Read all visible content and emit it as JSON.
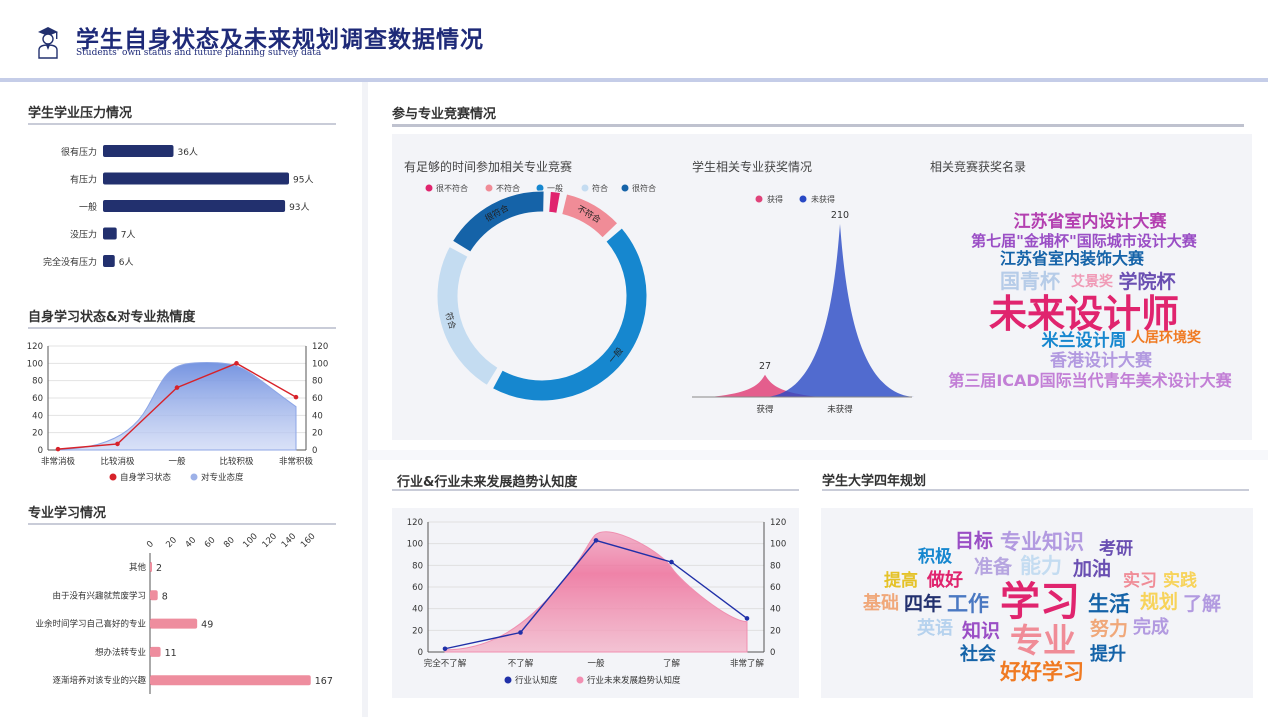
{
  "header": {
    "title": "学生自身状态及未来规划调查数据情况",
    "subtitle": "Students' own status and future planning survey data"
  },
  "sections": {
    "pressure": "学生学业压力情况",
    "study_state": "自身学习状态&对专业热情度",
    "major_study": "专业学习情况",
    "competition": "参与专业竞赛情况",
    "trend": "行业&行业未来发展趋势认知度",
    "plan": "学生大学四年规划"
  },
  "subtitles": {
    "time": "有足够的时间参加相关专业竞赛",
    "award": "学生相关专业获奖情况",
    "award_names": "相关竞赛获奖名录"
  },
  "colors": {
    "navy": "#22306e",
    "red": "#d7222a",
    "blue_area": "#7f9be0",
    "pink": "#ee8d9e",
    "pink_area": "#f07aa3",
    "line_blue": "#2030a8"
  },
  "chart_data": [
    {
      "id": "pressure",
      "type": "bar",
      "orientation": "horizontal",
      "categories": [
        "很有压力",
        "有压力",
        "一般",
        "没压力",
        "完全没有压力"
      ],
      "values": [
        36,
        95,
        93,
        7,
        6
      ],
      "value_labels": [
        "36人",
        "95人",
        "93人",
        "7人",
        "6人"
      ]
    },
    {
      "id": "study_state",
      "type": "line",
      "categories": [
        "非常消极",
        "比较消极",
        "一般",
        "比较积极",
        "非常积极"
      ],
      "ylim": [
        0,
        120
      ],
      "yticks": [
        "0",
        "20",
        "40",
        "60",
        "80",
        "100",
        "120"
      ],
      "series": [
        {
          "name": "自身学习状态",
          "type": "line",
          "values": [
            1,
            7,
            72,
            100,
            61
          ]
        },
        {
          "name": "对专业态度",
          "type": "area",
          "values": [
            1,
            8,
            90,
            86,
            50
          ]
        }
      ]
    },
    {
      "id": "major_study",
      "type": "bar",
      "orientation": "horizontal",
      "categories": [
        "其他",
        "由于没有兴趣就荒废学习",
        "业余时间学习自己喜好的专业",
        "想办法转专业",
        "逐渐培养对该专业的兴趣"
      ],
      "values": [
        2,
        8,
        49,
        11,
        167
      ],
      "xticks": [
        "0",
        "20",
        "40",
        "60",
        "80",
        "100",
        "120",
        "140",
        "160"
      ]
    },
    {
      "id": "time",
      "type": "pie",
      "legend": [
        "很不符合",
        "不符合",
        "一般",
        "符合",
        "很符合"
      ],
      "values": [
        2.5,
        10,
        45,
        25,
        17.5
      ],
      "colors": [
        "#e0246e",
        "#f08c97",
        "#1687cf",
        "#c4dcf1",
        "#1563a8"
      ],
      "slice_labels": [
        "",
        "不符合",
        "一般",
        "符合",
        "很符合"
      ]
    },
    {
      "id": "award",
      "type": "area",
      "categories": [
        "获得",
        "未获得"
      ],
      "legend": [
        "获得",
        "未获得"
      ],
      "values": [
        27,
        210
      ],
      "value_labels": [
        "27",
        "210"
      ],
      "colors": [
        "#e0437a",
        "#2848c4"
      ]
    },
    {
      "id": "trend",
      "type": "line",
      "categories": [
        "完全不了解",
        "不了解",
        "一般",
        "了解",
        "非常了解"
      ],
      "ylim": [
        0,
        120
      ],
      "yticks": [
        "0",
        "20",
        "40",
        "60",
        "80",
        "100",
        "120"
      ],
      "series": [
        {
          "name": "行业认知度",
          "type": "line",
          "values": [
            3,
            18,
            103,
            83,
            31
          ]
        },
        {
          "name": "行业未来发展趋势认知度",
          "type": "area",
          "values": [
            2,
            15,
            108,
            78,
            28
          ]
        }
      ]
    }
  ],
  "word_clouds": {
    "awards": [
      {
        "text": "江苏省室内设计大赛",
        "color": "#b33fb0",
        "size": 17,
        "x": 1090,
        "y": 227
      },
      {
        "text": "第七届\"金埔杯\"国际城市设计大赛",
        "color": "#9a4ec5",
        "size": 15,
        "x": 1084,
        "y": 246
      },
      {
        "text": "江苏省室内装饰大赛",
        "color": "#1563a8",
        "size": 16,
        "x": 1072,
        "y": 264
      },
      {
        "text": "国青杯",
        "color": "#b6cce8",
        "size": 20,
        "x": 1030,
        "y": 288
      },
      {
        "text": "艾景奖",
        "color": "#f09ab6",
        "size": 14,
        "x": 1092,
        "y": 286
      },
      {
        "text": "学院杯",
        "color": "#6a4fb2",
        "size": 19,
        "x": 1147,
        "y": 288
      },
      {
        "text": "未来设计师",
        "color": "#e0246e",
        "size": 38,
        "x": 1084,
        "y": 327
      },
      {
        "text": "米兰设计周",
        "color": "#1687cf",
        "size": 17,
        "x": 1084,
        "y": 346
      },
      {
        "text": "人居环境奖",
        "color": "#f07a22",
        "size": 14,
        "x": 1166,
        "y": 342
      },
      {
        "text": "香港设计大赛",
        "color": "#b29ae0",
        "size": 17,
        "x": 1101,
        "y": 366
      },
      {
        "text": "第三届ICAD国际当代青年美术设计大赛",
        "color": "#c27fd6",
        "size": 16,
        "x": 1090,
        "y": 386
      }
    ],
    "plan": [
      {
        "text": "目标",
        "color": "#9a4ec5",
        "size": 19,
        "x": 974,
        "y": 547
      },
      {
        "text": "专业知识",
        "color": "#b29ae0",
        "size": 21,
        "x": 1042,
        "y": 549
      },
      {
        "text": "考研",
        "color": "#6a4fb2",
        "size": 17,
        "x": 1116,
        "y": 554
      },
      {
        "text": "积极",
        "color": "#1687cf",
        "size": 17,
        "x": 935,
        "y": 562
      },
      {
        "text": "准备",
        "color": "#b6a5e0",
        "size": 19,
        "x": 993,
        "y": 573
      },
      {
        "text": "能力",
        "color": "#c4dcf1",
        "size": 21,
        "x": 1041,
        "y": 573
      },
      {
        "text": "加油",
        "color": "#6a4fb2",
        "size": 19,
        "x": 1092,
        "y": 575
      },
      {
        "text": "提高",
        "color": "#e5c228",
        "size": 17,
        "x": 901,
        "y": 586
      },
      {
        "text": "做好",
        "color": "#e0246e",
        "size": 18,
        "x": 945,
        "y": 586
      },
      {
        "text": "实习",
        "color": "#f08c97",
        "size": 17,
        "x": 1140,
        "y": 586
      },
      {
        "text": "实践",
        "color": "#f7d35a",
        "size": 17,
        "x": 1180,
        "y": 586
      },
      {
        "text": "学习",
        "color": "#e0246e",
        "size": 40,
        "x": 1040,
        "y": 615
      },
      {
        "text": "基础",
        "color": "#f0a87a",
        "size": 18,
        "x": 881,
        "y": 609
      },
      {
        "text": "四年",
        "color": "#22306e",
        "size": 19,
        "x": 923,
        "y": 610
      },
      {
        "text": "工作",
        "color": "#4a78c2",
        "size": 21,
        "x": 968,
        "y": 611
      },
      {
        "text": "生活",
        "color": "#1563a8",
        "size": 21,
        "x": 1109,
        "y": 611
      },
      {
        "text": "规划",
        "color": "#f7d35a",
        "size": 19,
        "x": 1159,
        "y": 608
      },
      {
        "text": "了解",
        "color": "#b29ae0",
        "size": 19,
        "x": 1202,
        "y": 610
      },
      {
        "text": "英语",
        "color": "#b6d2ee",
        "size": 18,
        "x": 935,
        "y": 634
      },
      {
        "text": "知识",
        "color": "#9a4ec5",
        "size": 19,
        "x": 981,
        "y": 637
      },
      {
        "text": "专业",
        "color": "#f08c97",
        "size": 33,
        "x": 1043,
        "y": 652
      },
      {
        "text": "努力",
        "color": "#f0a87a",
        "size": 19,
        "x": 1109,
        "y": 635
      },
      {
        "text": "完成",
        "color": "#b29ae0",
        "size": 18,
        "x": 1151,
        "y": 633
      },
      {
        "text": "社会",
        "color": "#1563a8",
        "size": 18,
        "x": 978,
        "y": 660
      },
      {
        "text": "提升",
        "color": "#1563a8",
        "size": 18,
        "x": 1108,
        "y": 660
      },
      {
        "text": "好好学习",
        "color": "#f07a22",
        "size": 21,
        "x": 1042,
        "y": 679
      }
    ]
  }
}
